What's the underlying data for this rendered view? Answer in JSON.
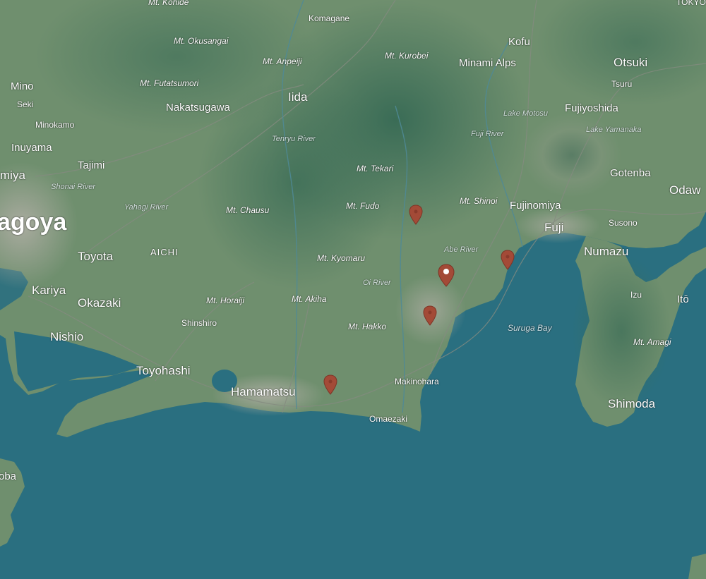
{
  "colors": {
    "sea": "#2a6f80",
    "land": "#6f8f6e",
    "mountains": "#3f6f58",
    "plains": "#93a28a",
    "urban": "#a3a79b",
    "pin": "#a34a37",
    "pin_center": "#ffffff"
  },
  "labels": {
    "tokyo_partial": "TOKYO",
    "mt_kohide": "Mt. Kohide",
    "komagane": "Komagane",
    "mt_okusangai": "Mt. Okusangai",
    "kofu": "Kofu",
    "mt_kurobei": "Mt. Kurobei",
    "mt_anpeiji": "Mt. Anpeiji",
    "otsuki": "Otsuki",
    "minami_alps": "Minami Alps",
    "tsuru": "Tsuru",
    "mino": "Mino",
    "mt_futatsumori": "Mt. Futatsumori",
    "seki": "Seki",
    "iida": "Iida",
    "nakatsugawa": "Nakatsugawa",
    "lake_motosu": "Lake Motosu",
    "fujiyoshida": "Fujiyoshida",
    "minokamo": "Minokamo",
    "lake_yamanaka": "Lake Yamanaka",
    "fuji_river": "Fuji River",
    "inuyama": "Inuyama",
    "tenryu_river": "Tenryu River",
    "tajimi": "Tajimi",
    "mt_tekari": "Mt. Tekari",
    "gotenba": "Gotenba",
    "miya_partial": "miya",
    "shonai_river": "Shonai River",
    "odawara_partial": "Odaw",
    "mt_shinoi": "Mt. Shinoi",
    "fujinomiya": "Fujinomiya",
    "yahagi_river": "Yahagi River",
    "mt_fudo": "Mt. Fudo",
    "mt_chausu": "Mt. Chausu",
    "susono": "Susono",
    "nagoya_partial": "agoya",
    "fuji": "Fuji",
    "aichi": "AICHI",
    "abe_river": "Abe River",
    "numazu": "Numazu",
    "toyota": "Toyota",
    "mt_kyomaru": "Mt. Kyomaru",
    "oi_river": "Oi River",
    "kariya": "Kariya",
    "izu": "Izu",
    "ito": "Itō",
    "okazaki": "Okazaki",
    "mt_horaiji": "Mt. Horaiji",
    "mt_akiha": "Mt. Akiha",
    "shinshiro": "Shinshiro",
    "mt_hakko": "Mt. Hakko",
    "suruga_bay": "Suruga Bay",
    "nishio": "Nishio",
    "mt_amagi": "Mt. Amagi",
    "toyohashi": "Toyohashi",
    "makinohara": "Makinohara",
    "hamamatsu": "Hamamatsu",
    "shimoda": "Shimoda",
    "omaezaki": "Omaezaki",
    "toba_partial": "oba"
  },
  "pins": [
    {
      "name": "map-pin-1",
      "selected": false
    },
    {
      "name": "map-pin-2",
      "selected": true
    },
    {
      "name": "map-pin-3",
      "selected": false
    },
    {
      "name": "map-pin-4",
      "selected": false
    },
    {
      "name": "map-pin-5",
      "selected": false
    }
  ]
}
